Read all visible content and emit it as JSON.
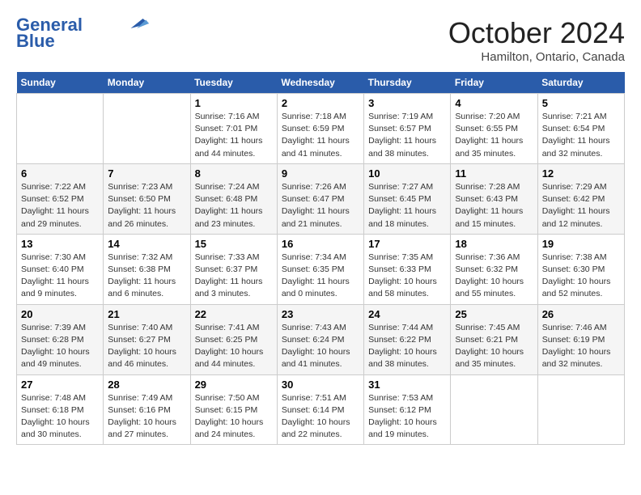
{
  "header": {
    "logo_line1": "General",
    "logo_line2": "Blue",
    "month": "October 2024",
    "location": "Hamilton, Ontario, Canada"
  },
  "weekdays": [
    "Sunday",
    "Monday",
    "Tuesday",
    "Wednesday",
    "Thursday",
    "Friday",
    "Saturday"
  ],
  "weeks": [
    [
      {
        "day": "",
        "sunrise": "",
        "sunset": "",
        "daylight": ""
      },
      {
        "day": "",
        "sunrise": "",
        "sunset": "",
        "daylight": ""
      },
      {
        "day": "1",
        "sunrise": "Sunrise: 7:16 AM",
        "sunset": "Sunset: 7:01 PM",
        "daylight": "Daylight: 11 hours and 44 minutes."
      },
      {
        "day": "2",
        "sunrise": "Sunrise: 7:18 AM",
        "sunset": "Sunset: 6:59 PM",
        "daylight": "Daylight: 11 hours and 41 minutes."
      },
      {
        "day": "3",
        "sunrise": "Sunrise: 7:19 AM",
        "sunset": "Sunset: 6:57 PM",
        "daylight": "Daylight: 11 hours and 38 minutes."
      },
      {
        "day": "4",
        "sunrise": "Sunrise: 7:20 AM",
        "sunset": "Sunset: 6:55 PM",
        "daylight": "Daylight: 11 hours and 35 minutes."
      },
      {
        "day": "5",
        "sunrise": "Sunrise: 7:21 AM",
        "sunset": "Sunset: 6:54 PM",
        "daylight": "Daylight: 11 hours and 32 minutes."
      }
    ],
    [
      {
        "day": "6",
        "sunrise": "Sunrise: 7:22 AM",
        "sunset": "Sunset: 6:52 PM",
        "daylight": "Daylight: 11 hours and 29 minutes."
      },
      {
        "day": "7",
        "sunrise": "Sunrise: 7:23 AM",
        "sunset": "Sunset: 6:50 PM",
        "daylight": "Daylight: 11 hours and 26 minutes."
      },
      {
        "day": "8",
        "sunrise": "Sunrise: 7:24 AM",
        "sunset": "Sunset: 6:48 PM",
        "daylight": "Daylight: 11 hours and 23 minutes."
      },
      {
        "day": "9",
        "sunrise": "Sunrise: 7:26 AM",
        "sunset": "Sunset: 6:47 PM",
        "daylight": "Daylight: 11 hours and 21 minutes."
      },
      {
        "day": "10",
        "sunrise": "Sunrise: 7:27 AM",
        "sunset": "Sunset: 6:45 PM",
        "daylight": "Daylight: 11 hours and 18 minutes."
      },
      {
        "day": "11",
        "sunrise": "Sunrise: 7:28 AM",
        "sunset": "Sunset: 6:43 PM",
        "daylight": "Daylight: 11 hours and 15 minutes."
      },
      {
        "day": "12",
        "sunrise": "Sunrise: 7:29 AM",
        "sunset": "Sunset: 6:42 PM",
        "daylight": "Daylight: 11 hours and 12 minutes."
      }
    ],
    [
      {
        "day": "13",
        "sunrise": "Sunrise: 7:30 AM",
        "sunset": "Sunset: 6:40 PM",
        "daylight": "Daylight: 11 hours and 9 minutes."
      },
      {
        "day": "14",
        "sunrise": "Sunrise: 7:32 AM",
        "sunset": "Sunset: 6:38 PM",
        "daylight": "Daylight: 11 hours and 6 minutes."
      },
      {
        "day": "15",
        "sunrise": "Sunrise: 7:33 AM",
        "sunset": "Sunset: 6:37 PM",
        "daylight": "Daylight: 11 hours and 3 minutes."
      },
      {
        "day": "16",
        "sunrise": "Sunrise: 7:34 AM",
        "sunset": "Sunset: 6:35 PM",
        "daylight": "Daylight: 11 hours and 0 minutes."
      },
      {
        "day": "17",
        "sunrise": "Sunrise: 7:35 AM",
        "sunset": "Sunset: 6:33 PM",
        "daylight": "Daylight: 10 hours and 58 minutes."
      },
      {
        "day": "18",
        "sunrise": "Sunrise: 7:36 AM",
        "sunset": "Sunset: 6:32 PM",
        "daylight": "Daylight: 10 hours and 55 minutes."
      },
      {
        "day": "19",
        "sunrise": "Sunrise: 7:38 AM",
        "sunset": "Sunset: 6:30 PM",
        "daylight": "Daylight: 10 hours and 52 minutes."
      }
    ],
    [
      {
        "day": "20",
        "sunrise": "Sunrise: 7:39 AM",
        "sunset": "Sunset: 6:28 PM",
        "daylight": "Daylight: 10 hours and 49 minutes."
      },
      {
        "day": "21",
        "sunrise": "Sunrise: 7:40 AM",
        "sunset": "Sunset: 6:27 PM",
        "daylight": "Daylight: 10 hours and 46 minutes."
      },
      {
        "day": "22",
        "sunrise": "Sunrise: 7:41 AM",
        "sunset": "Sunset: 6:25 PM",
        "daylight": "Daylight: 10 hours and 44 minutes."
      },
      {
        "day": "23",
        "sunrise": "Sunrise: 7:43 AM",
        "sunset": "Sunset: 6:24 PM",
        "daylight": "Daylight: 10 hours and 41 minutes."
      },
      {
        "day": "24",
        "sunrise": "Sunrise: 7:44 AM",
        "sunset": "Sunset: 6:22 PM",
        "daylight": "Daylight: 10 hours and 38 minutes."
      },
      {
        "day": "25",
        "sunrise": "Sunrise: 7:45 AM",
        "sunset": "Sunset: 6:21 PM",
        "daylight": "Daylight: 10 hours and 35 minutes."
      },
      {
        "day": "26",
        "sunrise": "Sunrise: 7:46 AM",
        "sunset": "Sunset: 6:19 PM",
        "daylight": "Daylight: 10 hours and 32 minutes."
      }
    ],
    [
      {
        "day": "27",
        "sunrise": "Sunrise: 7:48 AM",
        "sunset": "Sunset: 6:18 PM",
        "daylight": "Daylight: 10 hours and 30 minutes."
      },
      {
        "day": "28",
        "sunrise": "Sunrise: 7:49 AM",
        "sunset": "Sunset: 6:16 PM",
        "daylight": "Daylight: 10 hours and 27 minutes."
      },
      {
        "day": "29",
        "sunrise": "Sunrise: 7:50 AM",
        "sunset": "Sunset: 6:15 PM",
        "daylight": "Daylight: 10 hours and 24 minutes."
      },
      {
        "day": "30",
        "sunrise": "Sunrise: 7:51 AM",
        "sunset": "Sunset: 6:14 PM",
        "daylight": "Daylight: 10 hours and 22 minutes."
      },
      {
        "day": "31",
        "sunrise": "Sunrise: 7:53 AM",
        "sunset": "Sunset: 6:12 PM",
        "daylight": "Daylight: 10 hours and 19 minutes."
      },
      {
        "day": "",
        "sunrise": "",
        "sunset": "",
        "daylight": ""
      },
      {
        "day": "",
        "sunrise": "",
        "sunset": "",
        "daylight": ""
      }
    ]
  ]
}
